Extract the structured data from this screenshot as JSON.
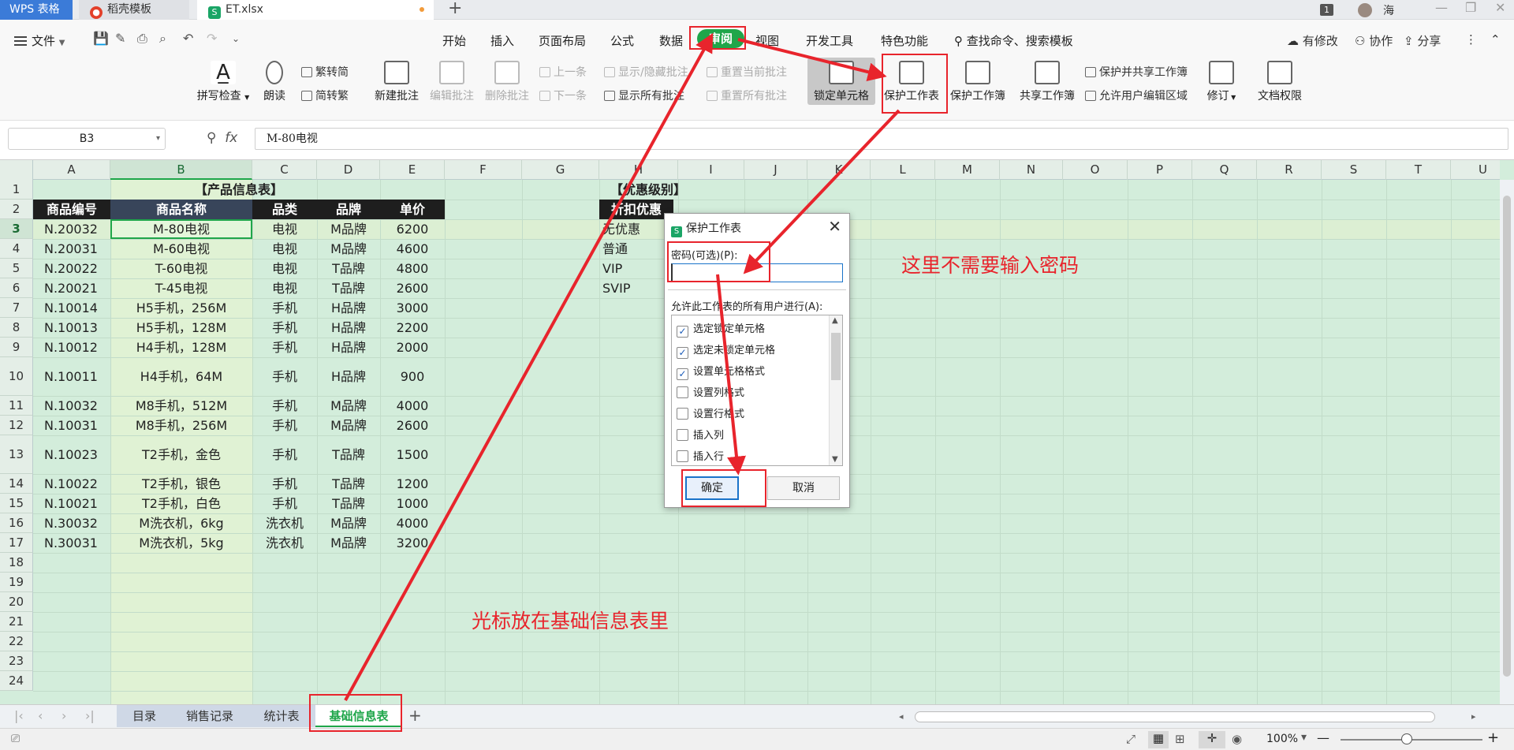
{
  "titlebar": {
    "tabs": [
      {
        "label": "WPS 表格"
      },
      {
        "label": "稻壳模板"
      },
      {
        "label": "ET.xlsx"
      }
    ],
    "badge": "1",
    "user": "海"
  },
  "menu": {
    "file": "文件",
    "tabs": [
      "开始",
      "插入",
      "页面布局",
      "公式",
      "数据",
      "审阅",
      "视图",
      "开发工具",
      "特色功能"
    ],
    "search": "查找命令、搜索模板",
    "right": [
      "有修改",
      "协作",
      "分享"
    ]
  },
  "ribbon": {
    "spellcheck": "拼写检查",
    "read": "朗读",
    "trad": "繁转简",
    "simp": "简转繁",
    "new_comment": "新建批注",
    "edit_comment": "编辑批注",
    "delete_comment": "删除批注",
    "prev": "上一条",
    "next": "下一条",
    "show_hide": "显示/隐藏批注",
    "show_all": "显示所有批注",
    "reset_current": "重置当前批注",
    "reset_all": "重置所有批注",
    "lock_cell": "锁定单元格",
    "protect_sheet": "保护工作表",
    "protect_book": "保护工作簿",
    "share_book": "共享工作簿",
    "protect_share": "保护并共享工作簿",
    "allow_edit": "允许用户编辑区域",
    "revise": "修订",
    "doc_rights": "文档权限"
  },
  "formula": {
    "namebox": "B3",
    "fx": "fx",
    "value": "M-80电视"
  },
  "grid": {
    "columns": [
      "A",
      "B",
      "C",
      "D",
      "E",
      "F",
      "G",
      "H",
      "I",
      "J",
      "K",
      "L",
      "M",
      "N",
      "O",
      "P",
      "Q",
      "R",
      "S",
      "T",
      "U"
    ],
    "rows": [
      "1",
      "2",
      "3",
      "4",
      "5",
      "6",
      "7",
      "8",
      "9",
      "10",
      "11",
      "12",
      "13",
      "14",
      "15",
      "16",
      "17",
      "18",
      "19",
      "20",
      "21",
      "22",
      "23",
      "24"
    ],
    "product_title": "【产品信息表】",
    "product_headers": [
      "商品编号",
      "商品名称",
      "品类",
      "品牌",
      "单价"
    ],
    "products": [
      [
        "N.20032",
        "M-80电视",
        "电视",
        "M品牌",
        "6200"
      ],
      [
        "N.20031",
        "M-60电视",
        "电视",
        "M品牌",
        "4600"
      ],
      [
        "N.20022",
        "T-60电视",
        "电视",
        "T品牌",
        "4800"
      ],
      [
        "N.20021",
        "T-45电视",
        "电视",
        "T品牌",
        "2600"
      ],
      [
        "N.10014",
        "H5手机，256M",
        "手机",
        "H品牌",
        "3000"
      ],
      [
        "N.10013",
        "H5手机，128M",
        "手机",
        "H品牌",
        "2200"
      ],
      [
        "N.10012",
        "H4手机，128M",
        "手机",
        "H品牌",
        "2000"
      ],
      [
        "N.10011",
        "H4手机，64M",
        "手机",
        "H品牌",
        "900"
      ],
      [
        "N.10032",
        "M8手机，512M",
        "手机",
        "M品牌",
        "4000"
      ],
      [
        "N.10031",
        "M8手机，256M",
        "手机",
        "M品牌",
        "2600"
      ],
      [
        "N.10023",
        "T2手机，金色",
        "手机",
        "T品牌",
        "1500"
      ],
      [
        "N.10022",
        "T2手机，银色",
        "手机",
        "T品牌",
        "1200"
      ],
      [
        "N.10021",
        "T2手机，白色",
        "手机",
        "T品牌",
        "1000"
      ],
      [
        "N.30032",
        "M洗衣机，6kg",
        "洗衣机",
        "M品牌",
        "4000"
      ],
      [
        "N.30031",
        "M洗衣机，5kg",
        "洗衣机",
        "M品牌",
        "3200"
      ]
    ],
    "discount_title": "【优惠级别】",
    "discount_header": "折扣优惠",
    "discounts": [
      "无优惠",
      "普通",
      "VIP",
      "SVIP"
    ]
  },
  "dialog": {
    "title": "保护工作表",
    "close": "✕",
    "password_label": "密码(可选)(P):",
    "password_value": "",
    "allow_label": "允许此工作表的所有用户进行(A):",
    "permissions": [
      {
        "label": "选定锁定单元格",
        "checked": true
      },
      {
        "label": "选定未锁定单元格",
        "checked": true
      },
      {
        "label": "设置单元格格式",
        "checked": true
      },
      {
        "label": "设置列格式",
        "checked": false
      },
      {
        "label": "设置行格式",
        "checked": false
      },
      {
        "label": "插入列",
        "checked": false
      },
      {
        "label": "插入行",
        "checked": false
      }
    ],
    "ok": "确定",
    "cancel": "取消"
  },
  "annotations": {
    "no_password": "这里不需要输入密码",
    "cursor_hint": "光标放在基础信息表里",
    "color": "#e8242c"
  },
  "sheets": [
    "目录",
    "销售记录",
    "统计表",
    "基础信息表"
  ],
  "status": {
    "zoom": "100%"
  },
  "colors": {
    "accent": "#1fa64a",
    "grid_bg": "#d3eddb",
    "header_dark": "#1e1e1e"
  }
}
